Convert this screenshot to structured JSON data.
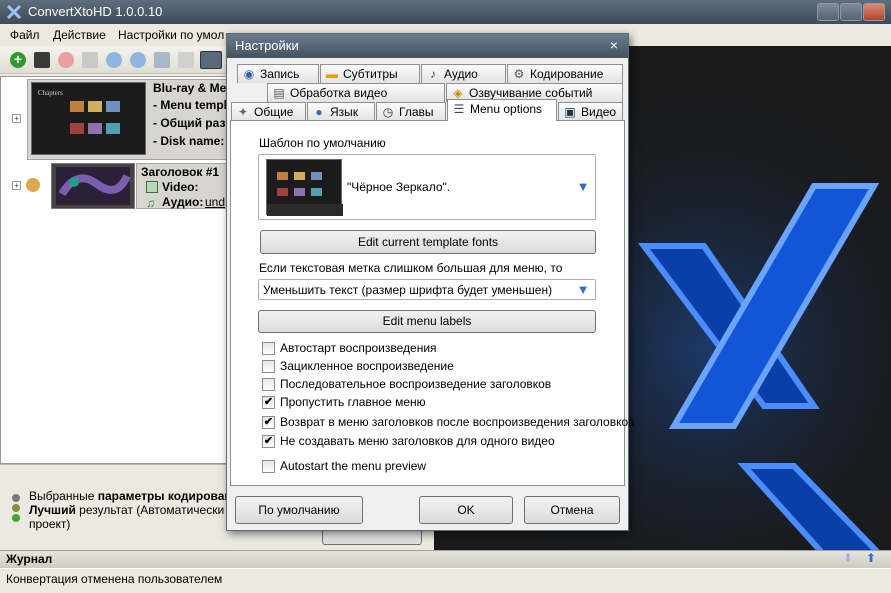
{
  "app": {
    "title": "ConvertXtoHD 1.0.0.10"
  },
  "menu": {
    "file": "Файл",
    "action": "Действие",
    "settings": "Настройки по умол"
  },
  "tree": {
    "project": {
      "title": "Blu-ray & Me",
      "line1": "- Menu templ",
      "line2": "- Общий разм",
      "line3": "- Disk name:"
    },
    "title1": {
      "title": "Заголовок #1",
      "video": "Video:",
      "audio": "Аудио:",
      "audio_value": "und"
    }
  },
  "encode_status": {
    "line1_prefix": "Выбранные ",
    "line1_bold": "параметры кодирован",
    "line2_bold": "Лучший",
    "line2_rest": " результат (Автоматически - (",
    "line3": "проект)"
  },
  "journal": {
    "label": "Журнал"
  },
  "status": {
    "text": "Конвертация отменена пользователем"
  },
  "dialog": {
    "title": "Настройки",
    "tabs_row1": [
      "Запись",
      "Субтитры",
      "Аудио",
      "Кодирование"
    ],
    "tabs_row2": [
      "Обработка видео",
      "Озвучивание событий"
    ],
    "tabs_row3": [
      "Общие",
      "Язык",
      "Главы",
      "Menu options",
      "Видео"
    ],
    "default_template_label": "Шаблон по умолчанию",
    "template_name": "\"Чёрное Зеркало\".",
    "edit_fonts_button": "Edit current template fonts",
    "overflow_label": "Если текстовая метка слишком большая для меню, то",
    "overflow_value": "Уменьшить текст (размер шрифта будет уменьшен)",
    "edit_labels_button": "Edit menu labels",
    "checkboxes": [
      {
        "label": "Автостарт воспроизведения",
        "checked": false
      },
      {
        "label": "Зацикленное воспроизведение",
        "checked": false
      },
      {
        "label": "Последовательное воспроизведение заголовков",
        "checked": false
      },
      {
        "label": "Пропустить главное меню",
        "checked": true
      },
      {
        "label": "Возврат в меню заголовков после воспроизведения заголовков",
        "checked": true
      },
      {
        "label": "Не создавать меню заголовков для одного видео",
        "checked": true
      },
      {
        "label": "Autostart the menu preview",
        "checked": false
      }
    ],
    "default_button": "По умолчанию",
    "ok_button": "OK",
    "cancel_button": "Отмена",
    "close_glyph": "×"
  },
  "menu_thumb_title": "Chapters",
  "colors": {
    "accent_blue": "#1e6fff",
    "preview_bg": "#1a1a1a"
  }
}
